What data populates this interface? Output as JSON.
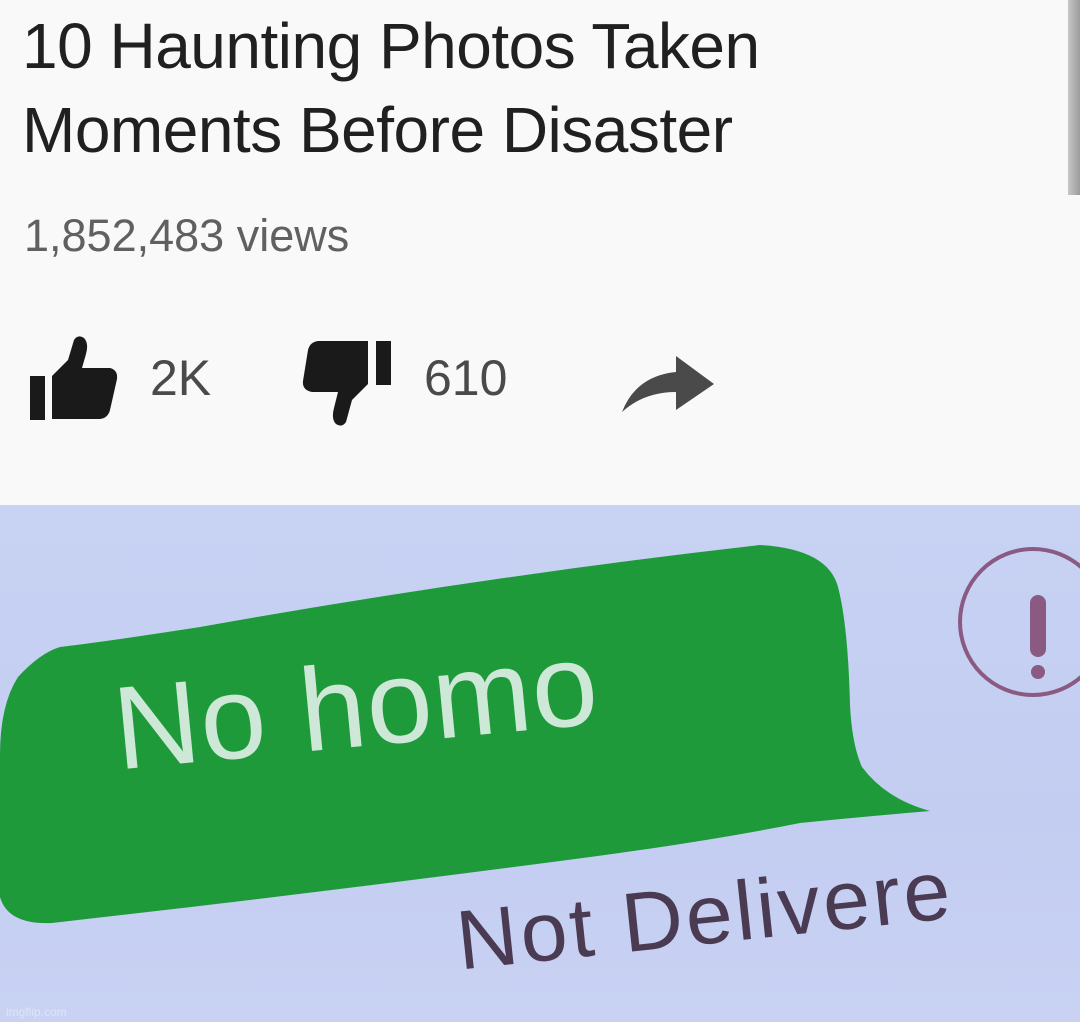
{
  "video": {
    "title": "10 Haunting Photos Taken Moments Before Disaster",
    "views": "1,852,483 views",
    "actions": {
      "like": {
        "icon": "thumbs-up-icon",
        "count": "2K"
      },
      "dislike": {
        "icon": "thumbs-down-icon",
        "count": "610"
      },
      "share": {
        "icon": "share-arrow-icon"
      }
    }
  },
  "message": {
    "text": "No homo",
    "status": "Not Delivere",
    "status_icon": "exclamation-circle-icon",
    "colors": {
      "bubble": "#1e9a3b",
      "bubble_text": "#cde8d6",
      "background": "#c6d0f2",
      "status_text": "#4a3b52",
      "alert": "#8a5a82"
    }
  },
  "watermark": "imgflip.com"
}
